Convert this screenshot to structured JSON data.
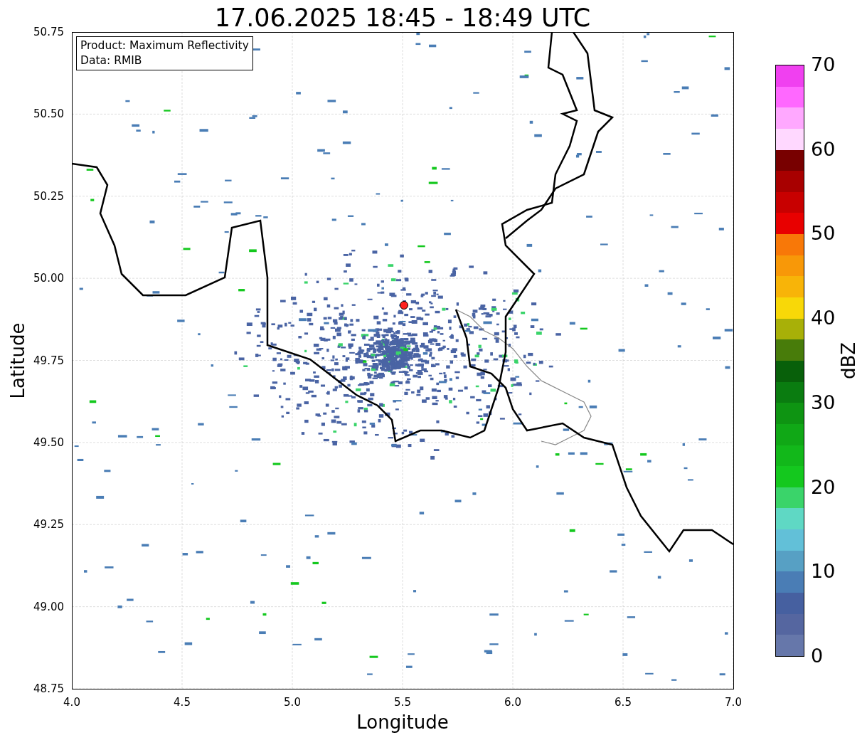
{
  "title": "17.06.2025 18:45 - 18:49 UTC",
  "legend": [
    "Product: Maximum Reflectivity",
    "Data: RMIB"
  ],
  "map": {
    "xlabel": "Longitude",
    "ylabel": "Latitude",
    "xticks": [
      "4.0",
      "4.5",
      "5.0",
      "5.5",
      "6.0",
      "6.5",
      "7.0"
    ],
    "yticks": [
      "50.75",
      "50.50",
      "50.25",
      "50.00",
      "49.75",
      "49.50",
      "49.25",
      "49.00",
      "48.75"
    ]
  },
  "colorbar": {
    "label": "dBZ",
    "ticks": [
      "70",
      "60",
      "50",
      "40",
      "30",
      "20",
      "10",
      "0"
    ],
    "segments": [
      {
        "color": "#f040f0"
      },
      {
        "color": "#ff68ff"
      },
      {
        "color": "#ffa8ff"
      },
      {
        "color": "#ffd8ff"
      },
      {
        "color": "#780000"
      },
      {
        "color": "#a80000"
      },
      {
        "color": "#c80000"
      },
      {
        "color": "#e80000"
      },
      {
        "color": "#f87808"
      },
      {
        "color": "#f89808"
      },
      {
        "color": "#f8b408"
      },
      {
        "color": "#f8d808"
      },
      {
        "color": "#a8b008"
      },
      {
        "color": "#487c0a"
      },
      {
        "color": "#08600a"
      },
      {
        "color": "#0a7c10"
      },
      {
        "color": "#0e9412"
      },
      {
        "color": "#10a816"
      },
      {
        "color": "#12b81a"
      },
      {
        "color": "#14c81e"
      },
      {
        "color": "#3ad46a"
      },
      {
        "color": "#5fd8c4"
      },
      {
        "color": "#62c0d8"
      },
      {
        "color": "#57a0c4"
      },
      {
        "color": "#4a7db5"
      },
      {
        "color": "#4660a0"
      },
      {
        "color": "#5566a0"
      },
      {
        "color": "#6677aa"
      }
    ]
  }
}
